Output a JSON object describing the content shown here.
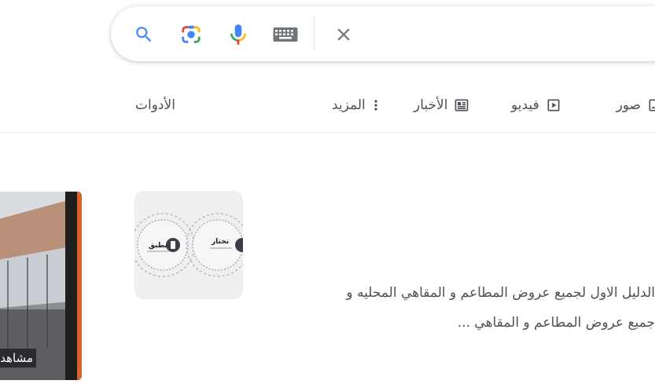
{
  "search": {
    "value": "",
    "icons": {
      "search": "search-icon",
      "lens": "camera-lens-icon",
      "mic": "microphone-icon",
      "keyboard": "keyboard-icon",
      "clear": "close-icon"
    }
  },
  "tabs": {
    "images": {
      "label": "صور",
      "icon": "image-icon"
    },
    "videos": {
      "label": "فيديو",
      "icon": "play-icon"
    },
    "news": {
      "label": "الأخبار",
      "icon": "newspaper-icon"
    },
    "more": {
      "label": "المزيد",
      "icon": "more-vert-icon"
    },
    "tools": {
      "label": "الأدوات"
    }
  },
  "result": {
    "snippet_line1": "الدليل الاول لجميع عروض المطاعم و المقاهي المحليه و",
    "snippet_line2": "جميع عروض المطاعم و المقاهي ...",
    "thumbnail": {
      "left_label": "نطبق",
      "right_label": "نختار"
    }
  },
  "video": {
    "label": "مشاهد"
  },
  "colors": {
    "google_blue": "#4285f4",
    "google_red": "#ea4335",
    "google_yellow": "#fbbc04",
    "google_green": "#34a853",
    "icon_gray": "#70757a",
    "text_gray": "#4d5156"
  }
}
